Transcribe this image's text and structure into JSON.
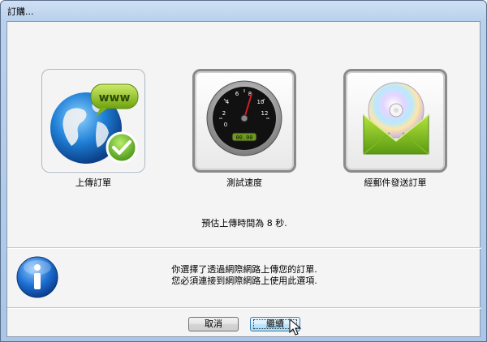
{
  "window": {
    "title": "訂購..."
  },
  "options": [
    {
      "label": "上傳訂單",
      "icon": "globe-www-check-icon",
      "selected": true
    },
    {
      "label": "測試速度",
      "icon": "speedometer-icon",
      "selected": false
    },
    {
      "label": "經郵件發送訂單",
      "icon": "cd-envelope-icon",
      "selected": false
    }
  ],
  "speedometer": {
    "ticks": [
      "2",
      "4",
      "6",
      "8",
      "10",
      "12",
      "0"
    ],
    "readout": "00.00"
  },
  "estimate_text": "預估上傳時間為 8 秒.",
  "info": {
    "icon": "info-icon",
    "line1": "你選擇了透過網際網路上傳您的訂單.",
    "line2": "您必須連接到網際網路上使用此選項."
  },
  "buttons": {
    "cancel": "取消",
    "continue": "繼續"
  },
  "colors": {
    "title_bar": "#b9d1ec",
    "dialog_bg": "#f4f4f4",
    "primary_button": "#bee6fd"
  }
}
